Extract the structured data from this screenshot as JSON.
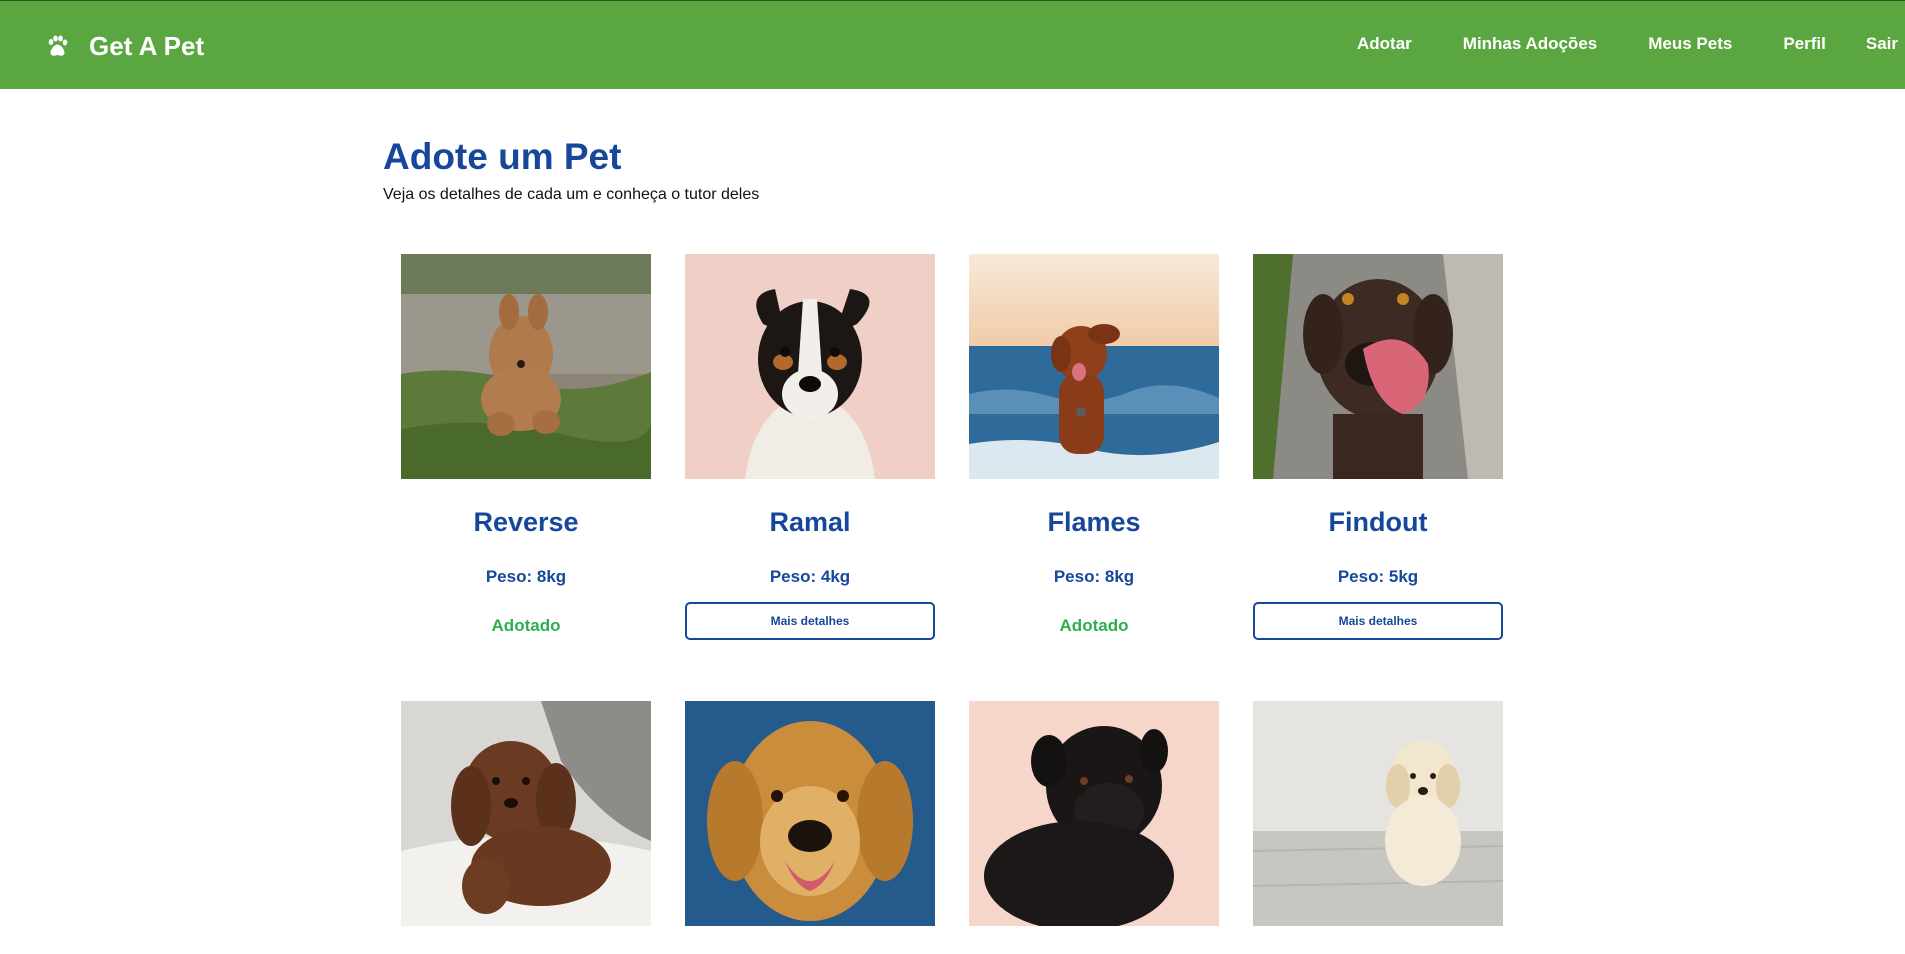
{
  "navbar": {
    "brand": "Get A Pet",
    "brand_icon": "paw-icon",
    "links": [
      "Adotar",
      "Minhas Adoções",
      "Meus Pets",
      "Perfil",
      "Sair"
    ],
    "background": "#5aa641"
  },
  "header": {
    "title": "Adote um Pet",
    "subtitle": "Veja os detalhes de cada um e conheça o tutor deles"
  },
  "colors": {
    "title": "#16479b",
    "adopted": "#2eae4d"
  },
  "pets": [
    {
      "name": "Reverse",
      "weight": "Peso: 8kg",
      "status": "Adotado",
      "action": ""
    },
    {
      "name": "Ramal",
      "weight": "Peso: 4kg",
      "status": "",
      "action": "Mais detalhes"
    },
    {
      "name": "Flames",
      "weight": "Peso: 8kg",
      "status": "Adotado",
      "action": ""
    },
    {
      "name": "Findout",
      "weight": "Peso: 5kg",
      "status": "",
      "action": "Mais detalhes"
    }
  ]
}
